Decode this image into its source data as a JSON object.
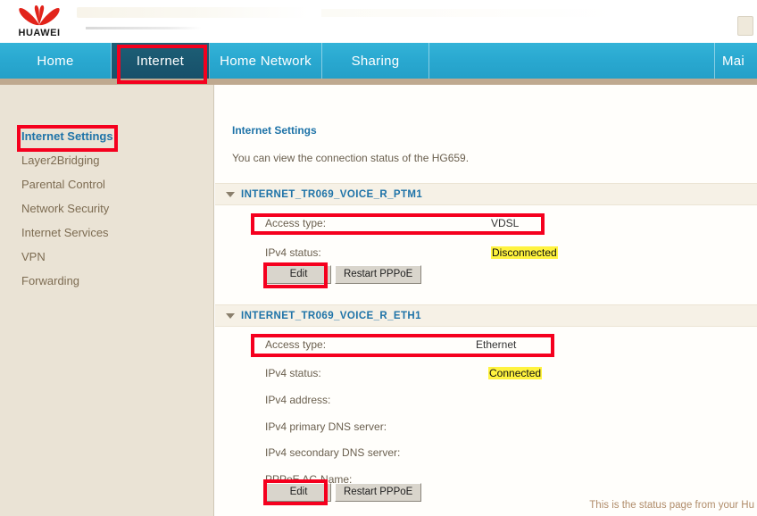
{
  "branding": {
    "logo_text": "HUAWEI",
    "logo_icon": "huawei-flower-logo"
  },
  "nav": {
    "items": [
      {
        "label": "Home",
        "active": false
      },
      {
        "label": "Internet",
        "active": true
      },
      {
        "label": "Home Network",
        "active": false
      },
      {
        "label": "Sharing",
        "active": false
      },
      {
        "label": "Mai",
        "active": false
      }
    ]
  },
  "sidebar": {
    "items": [
      {
        "label": "Internet Settings",
        "active": true
      },
      {
        "label": "Layer2Bridging",
        "active": false
      },
      {
        "label": "Parental Control",
        "active": false
      },
      {
        "label": "Network Security",
        "active": false
      },
      {
        "label": "Internet Services",
        "active": false
      },
      {
        "label": "VPN",
        "active": false
      },
      {
        "label": "Forwarding",
        "active": false
      }
    ]
  },
  "main": {
    "title": "Internet Settings",
    "description": "You can view the connection status of the HG659.",
    "sections": [
      {
        "name": "INTERNET_TR069_VOICE_R_PTM1",
        "caret_icon": "chevron-down-icon",
        "fields": [
          {
            "label": "Access type:",
            "value": "VDSL",
            "highlight": false
          },
          {
            "label": "IPv4 status:",
            "value": "Disconnected",
            "highlight": true
          }
        ],
        "buttons": [
          {
            "label": "Edit"
          },
          {
            "label": "Restart PPPoE"
          }
        ]
      },
      {
        "name": "INTERNET_TR069_VOICE_R_ETH1",
        "caret_icon": "chevron-down-icon",
        "fields": [
          {
            "label": "Access type:",
            "value": "Ethernet",
            "highlight": false
          },
          {
            "label": "IPv4 status:",
            "value": "Connected",
            "highlight": true
          },
          {
            "label": "IPv4 address:",
            "value": "",
            "highlight": false
          },
          {
            "label": "IPv4 primary DNS server:",
            "value": "",
            "highlight": false
          },
          {
            "label": "IPv4 secondary DNS server:",
            "value": "",
            "highlight": false
          },
          {
            "label": "PPPoE AC-Name:",
            "value": "",
            "highlight": false
          }
        ],
        "buttons": [
          {
            "label": "Edit"
          },
          {
            "label": "Restart PPPoE"
          }
        ]
      }
    ]
  },
  "footnote": {
    "text": "This is the status page from your Hu"
  },
  "colors": {
    "nav_background": "#29a8d0",
    "nav_active": "#17506a",
    "sidebar_background": "#eae3d5",
    "accent_link": "#1e73a8",
    "label_text": "#6a5f4e",
    "highlight_yellow": "#fff33f",
    "annotation_red": "#f5001e",
    "logo_red": "#e2231a"
  }
}
